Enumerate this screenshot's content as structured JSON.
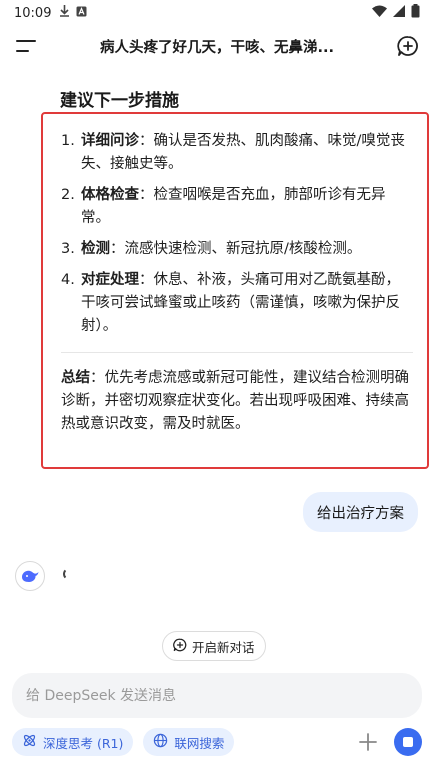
{
  "status_bar": {
    "time": "10:09"
  },
  "header": {
    "title": "病人头疼了好几天，干咳、无鼻涕..."
  },
  "response": {
    "section_title": "建议下一步措施",
    "steps": [
      {
        "num": "1.",
        "label": "详细问诊",
        "text": "：确认是否发热、肌肉酸痛、味觉/嗅觉丧失、接触史等。"
      },
      {
        "num": "2.",
        "label": "体格检查",
        "text": "：检查咽喉是否充血，肺部听诊有无异常。"
      },
      {
        "num": "3.",
        "label": "检测",
        "text": "：流感快速检测、新冠抗原/核酸检测。"
      },
      {
        "num": "4.",
        "label": "对症处理",
        "text": "：休息、补液，头痛可用对乙酰氨基酚，干咳可尝试蜂蜜或止咳药（需谨慎，咳嗽为保护反射）。"
      }
    ],
    "summary_label": "总结",
    "summary_text": "：优先考虑流感或新冠可能性，建议结合检测明确诊断，并密切观察症状变化。若出现呼吸困难、持续高热或意识改变，需及时就医。"
  },
  "user_message": "给出治疗方案",
  "new_chat_label": "开启新对话",
  "input": {
    "placeholder": "给 DeepSeek 发送消息",
    "value": ""
  },
  "tools": {
    "deep_think": "深度思考 (R1)",
    "web_search": "联网搜索"
  },
  "colors": {
    "accent": "#3a6cf0",
    "highlight_border": "#e03a3a",
    "chip_bg": "#e8f0fe"
  }
}
